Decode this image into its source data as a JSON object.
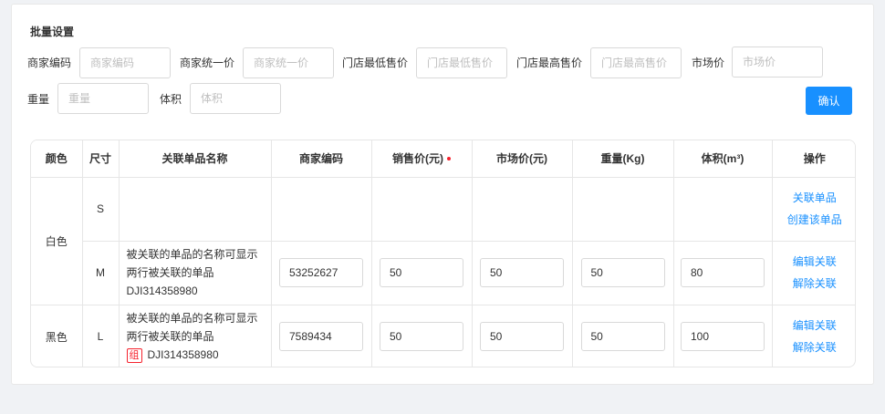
{
  "section_title": "批量设置",
  "batch_form": {
    "merchant_code": {
      "label": "商家编码",
      "placeholder": "商家编码"
    },
    "unified_price": {
      "label": "商家统一价",
      "placeholder": "商家统一价"
    },
    "store_min_price": {
      "label": "门店最低售价",
      "placeholder": "门店最低售价"
    },
    "store_max_price": {
      "label": "门店最高售价",
      "placeholder": "门店最高售价"
    },
    "market_price": {
      "label": "市场价",
      "placeholder": "市场价"
    },
    "weight": {
      "label": "重量",
      "placeholder": "重量"
    },
    "volume": {
      "label": "体积",
      "placeholder": "体积"
    },
    "confirm_label": "确认"
  },
  "table": {
    "headers": {
      "color": "颜色",
      "size": "尺寸",
      "linked_name": "关联单品名称",
      "merchant_code": "商家编码",
      "sale_price": "销售价(元)",
      "market_price": "市场价(元)",
      "weight": "重量(Kg)",
      "volume": "体积(m³)",
      "ops": "操作"
    },
    "colors": {
      "white": "白色",
      "black": "黑色"
    },
    "rows": [
      {
        "size": "S",
        "ops": [
          "关联单品",
          "创建该单品"
        ]
      },
      {
        "size": "M",
        "name_text": "被关联的单品的名称可显示两行被关联的单品",
        "sku": "DJI314358980",
        "merchant_code": "53252627",
        "sale_price": "50",
        "market_price": "50",
        "weight": "50",
        "volume": "80",
        "ops": [
          "编辑关联",
          "解除关联"
        ]
      },
      {
        "size": "L",
        "name_text": "被关联的单品的名称可显示两行被关联的单品",
        "badge": "组",
        "sku": "DJI314358980",
        "merchant_code": "7589434",
        "sale_price": "50",
        "market_price": "50",
        "weight": "50",
        "volume": "100",
        "ops": [
          "编辑关联",
          "解除关联"
        ]
      }
    ]
  },
  "colors": {
    "accent": "#1890ff",
    "required_dot": "#f5222d",
    "border": "#e6e6e6"
  }
}
